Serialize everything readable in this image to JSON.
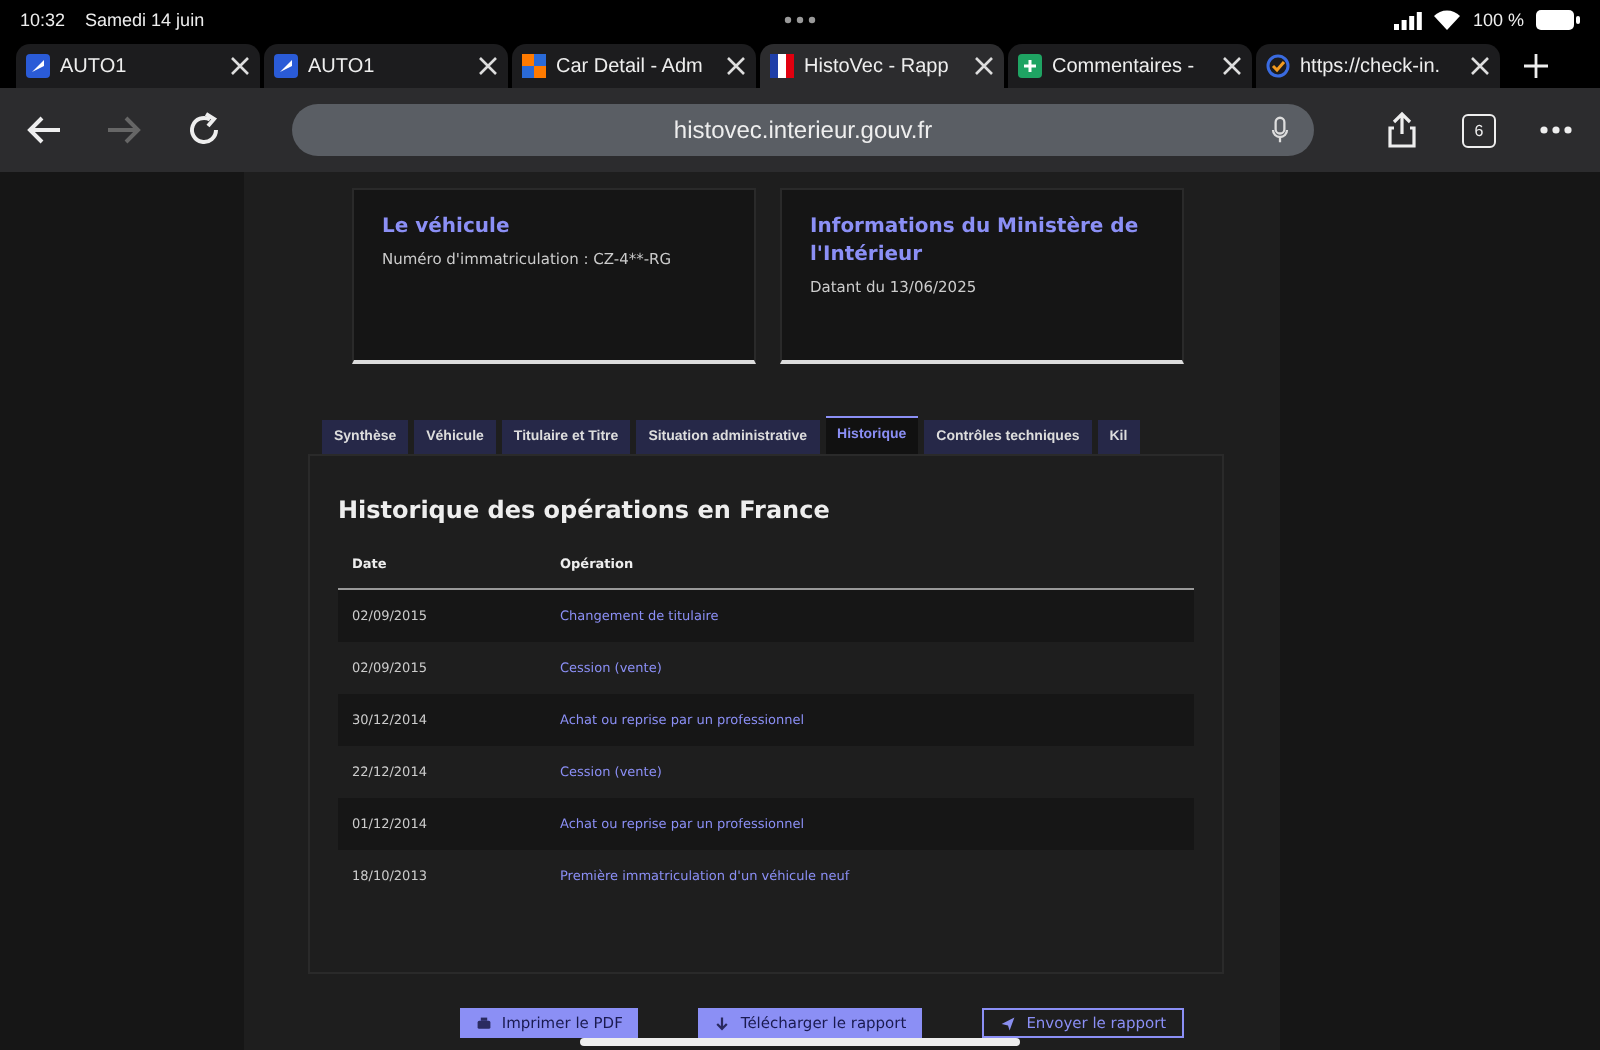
{
  "status_bar": {
    "time": "10:32",
    "date": "Samedi 14 juin",
    "battery": "100 %"
  },
  "browser_tabs": [
    {
      "title": "AUTO1",
      "selected": false
    },
    {
      "title": "AUTO1",
      "selected": false
    },
    {
      "title": "Car Detail - Adm",
      "selected": false
    },
    {
      "title": "HistoVec - Rapp",
      "selected": true
    },
    {
      "title": "Commentaires -",
      "selected": false
    },
    {
      "title": "https://check-in.",
      "selected": false
    }
  ],
  "toolbar": {
    "url": "histovec.interieur.gouv.fr",
    "tab_count": "6"
  },
  "cards": [
    {
      "title": "Le véhicule",
      "text": "Numéro d'immatriculation : CZ-4**-RG"
    },
    {
      "title": "Informations du Ministère de l'Intérieur",
      "text": "Datant du 13/06/2025"
    }
  ],
  "tabs": [
    {
      "label": "Synthèse",
      "selected": false
    },
    {
      "label": "Véhicule",
      "selected": false
    },
    {
      "label": "Titulaire et Titre",
      "selected": false
    },
    {
      "label": "Situation administrative",
      "selected": false
    },
    {
      "label": "Historique",
      "selected": true
    },
    {
      "label": "Contrôles techniques",
      "selected": false
    },
    {
      "label": "Kil",
      "selected": false
    }
  ],
  "panel": {
    "title": "Historique des opérations en France",
    "table": {
      "columns": [
        "Date",
        "Opération"
      ],
      "rows": [
        [
          "02/09/2015",
          "Changement de titulaire"
        ],
        [
          "02/09/2015",
          "Cession (vente)"
        ],
        [
          "30/12/2014",
          "Achat ou reprise par un professionnel"
        ],
        [
          "22/12/2014",
          "Cession (vente)"
        ],
        [
          "01/12/2014",
          "Achat ou reprise par un professionnel"
        ],
        [
          "18/10/2013",
          "Première immatriculation d'un véhicule neuf"
        ]
      ]
    }
  },
  "actions": [
    {
      "label": "Imprimer le PDF",
      "kind": "print"
    },
    {
      "label": "Télécharger le rapport",
      "kind": "download"
    },
    {
      "label": "Envoyer le rapport",
      "kind": "send"
    }
  ]
}
